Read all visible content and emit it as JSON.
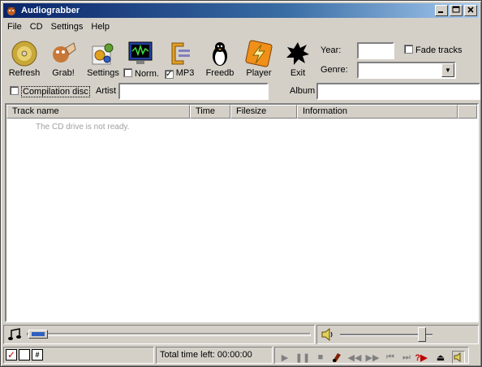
{
  "window": {
    "title": "Audiograbber",
    "minimize": "_",
    "maximize": "□",
    "close": "×"
  },
  "menu": [
    "File",
    "CD",
    "Settings",
    "Help"
  ],
  "toolbar": {
    "refresh": "Refresh",
    "grab": "Grab!",
    "settings": "Settings",
    "norm": "Norm.",
    "mp3": "MP3",
    "freedb": "Freedb",
    "player": "Player",
    "exit": "Exit",
    "norm_checked": false,
    "mp3_checked": true
  },
  "fields": {
    "year_label": "Year:",
    "year_value": "",
    "genre_label": "Genre:",
    "genre_value": "",
    "fade_label": "Fade tracks",
    "fade_checked": false,
    "compilation_label": "Compilation disc",
    "compilation_checked": false,
    "artist_label": "Artist",
    "artist_value": "",
    "album_label": "Album",
    "album_value": ""
  },
  "list": {
    "columns": [
      "Track name",
      "Time",
      "Filesize",
      "Information"
    ],
    "empty_message": "The CD drive is not ready."
  },
  "status": {
    "total_time": "Total time left: 00:00:00"
  },
  "colors": {
    "title_start": "#0a246a",
    "title_end": "#a6caf0",
    "face": "#d4d0c8"
  }
}
